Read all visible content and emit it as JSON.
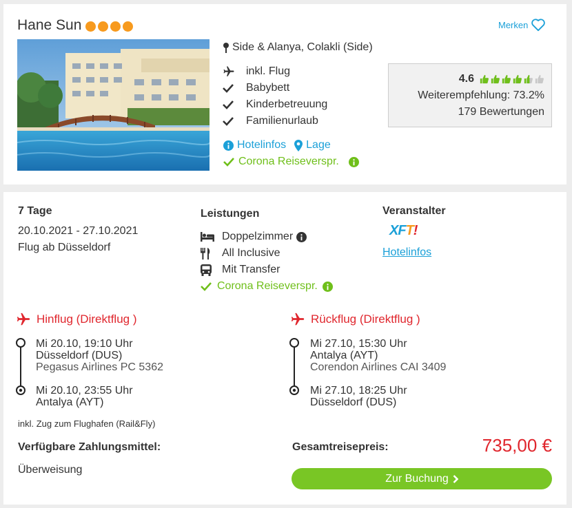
{
  "hotel": {
    "name": "Hane Sun",
    "stars": 4,
    "merken_label": "Merken",
    "location": "Side & Alanya, Colakli (Side)",
    "features": [
      "inkl. Flug",
      "Babybett",
      "Kinderbetreuung",
      "Familienurlaub"
    ],
    "hotelinfos_label": "Hotelinfos",
    "lage_label": "Lage",
    "corona_label": "Corona Reiseverspr.",
    "rating": {
      "score": "4.6",
      "thumbs_value": 4.6,
      "thumbs_max": 6,
      "recommendation": "Weiterempfehlung: 73.2%",
      "reviews": "179 Bewertungen"
    }
  },
  "offer": {
    "duration": "7 Tage",
    "dates": "20.10.2021 - 27.10.2021",
    "flight_from": "Flug ab Düsseldorf",
    "leistungen_title": "Leistungen",
    "leistungen": [
      "Doppelzimmer",
      "All Inclusive",
      "Mit Transfer"
    ],
    "corona_label": "Corona Reiseverspr.",
    "veranstalter_title": "Veranstalter",
    "veranstalter_logo": "XFTI",
    "veranstalter_link": "Hotelinfos"
  },
  "flights": {
    "hin": {
      "title": "Hinflug (Direktflug )",
      "dep_time": "Mi 20.10, 19:10 Uhr",
      "dep_airport": "Düsseldorf (DUS)",
      "airline": "Pegasus Airlines PC 5362",
      "arr_time": "Mi 20.10, 23:55 Uhr",
      "arr_airport": "Antalya (AYT)"
    },
    "rueck": {
      "title": "Rückflug (Direktflug )",
      "dep_time": "Mi 27.10, 15:30 Uhr",
      "dep_airport": "Antalya (AYT)",
      "airline": "Corendon Airlines CAI 3409",
      "arr_time": "Mi 27.10, 18:25 Uhr",
      "arr_airport": "Düsseldorf (DUS)"
    },
    "rail_note": "inkl. Zug zum Flughafen (Rail&Fly)"
  },
  "payment": {
    "title": "Verfügbare Zahlungsmittel:",
    "method": "Überweisung"
  },
  "price": {
    "label": "Gesamtreisepreis:",
    "value": "735,00 €"
  },
  "booking_button": "Zur Buchung",
  "colors": {
    "accent_blue": "#1ba0d8",
    "green": "#6fbf1a",
    "red": "#e0262d",
    "star_orange": "#f79a1e",
    "button_green": "#79c625"
  }
}
